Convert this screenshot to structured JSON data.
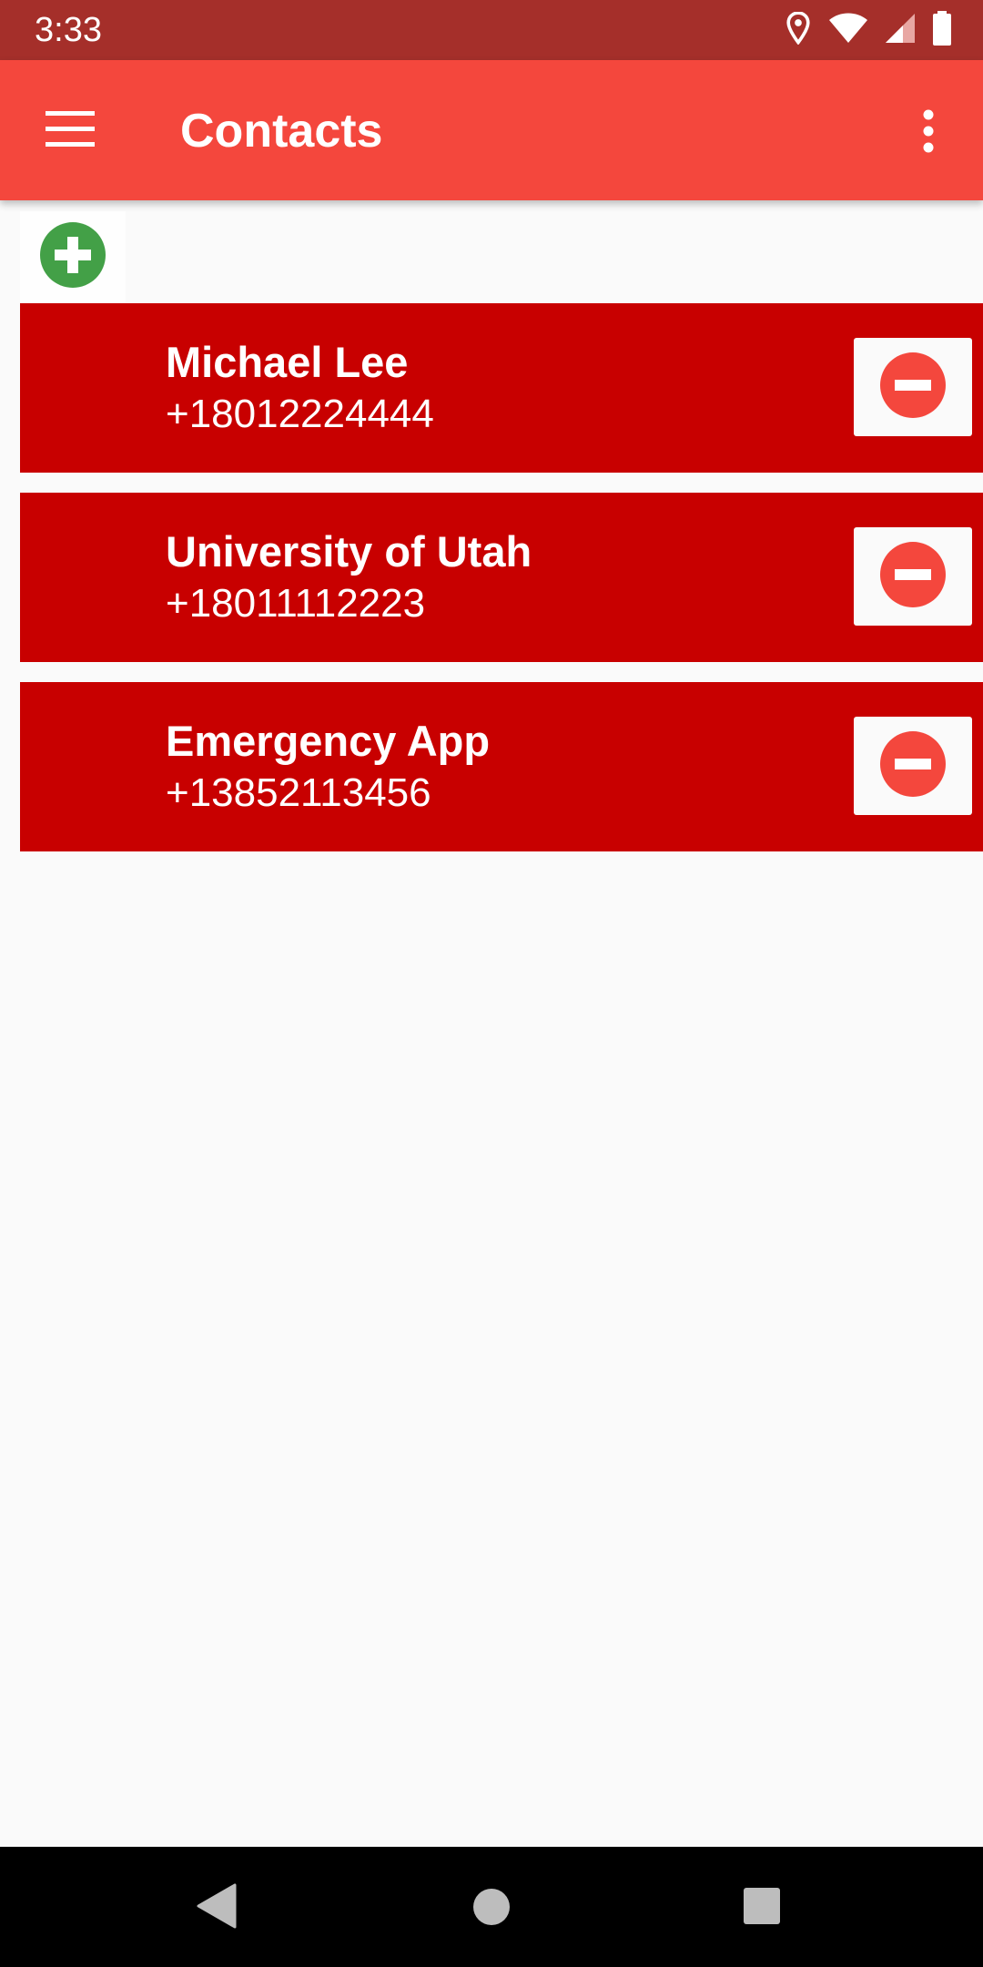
{
  "status_bar": {
    "time": "3:33",
    "icons": [
      "location-icon",
      "wifi-icon",
      "cell-signal-icon",
      "battery-icon"
    ]
  },
  "app_bar": {
    "title": "Contacts",
    "menu_icon": "hamburger-menu-icon",
    "overflow_icon": "more-vert-icon"
  },
  "add_button": {
    "icon": "add-circle-icon",
    "color": "#43a047"
  },
  "contacts": [
    {
      "name": "Michael Lee",
      "phone": "+18012224444"
    },
    {
      "name": "University of Utah",
      "phone": "+18011112223"
    },
    {
      "name": "Emergency App",
      "phone": "+13852113456"
    }
  ],
  "remove_icon": "remove-circle-icon",
  "colors": {
    "status_bar": "#a52f2a",
    "app_bar": "#f4473d",
    "contact_row": "#c80000",
    "remove_icon": "#f4473d",
    "background": "#fafafa"
  },
  "nav_bar": {
    "icons": [
      "back-icon",
      "home-icon",
      "recents-icon"
    ]
  }
}
